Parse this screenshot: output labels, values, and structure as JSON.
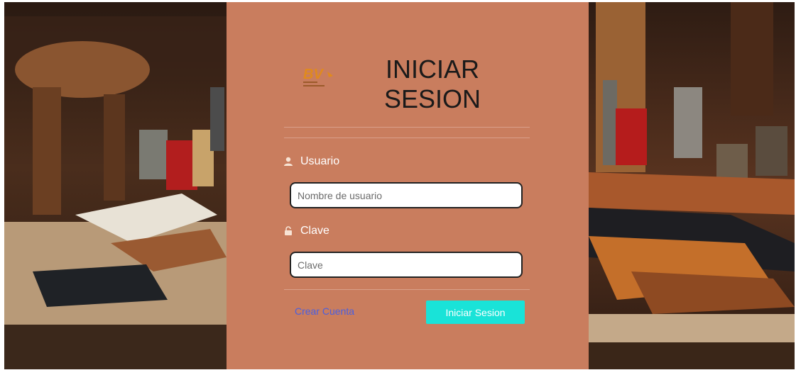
{
  "logo": {
    "text": "BV",
    "brand_color": "#e08a1e"
  },
  "header": {
    "title_line1": "INICIAR",
    "title_line2": "SESION"
  },
  "form": {
    "username_label": "Usuario",
    "username_icon": "user-icon",
    "username_placeholder": "Nombre de usuario",
    "username_value": "",
    "password_label": "Clave",
    "password_icon": "lock-icon",
    "password_placeholder": "Clave",
    "password_value": ""
  },
  "actions": {
    "create_account": "Crear Cuenta",
    "submit": "Iniciar Sesion"
  },
  "colors": {
    "panel": "#c97d5e",
    "button": "#19e3d8",
    "link": "#4a5fe0"
  }
}
